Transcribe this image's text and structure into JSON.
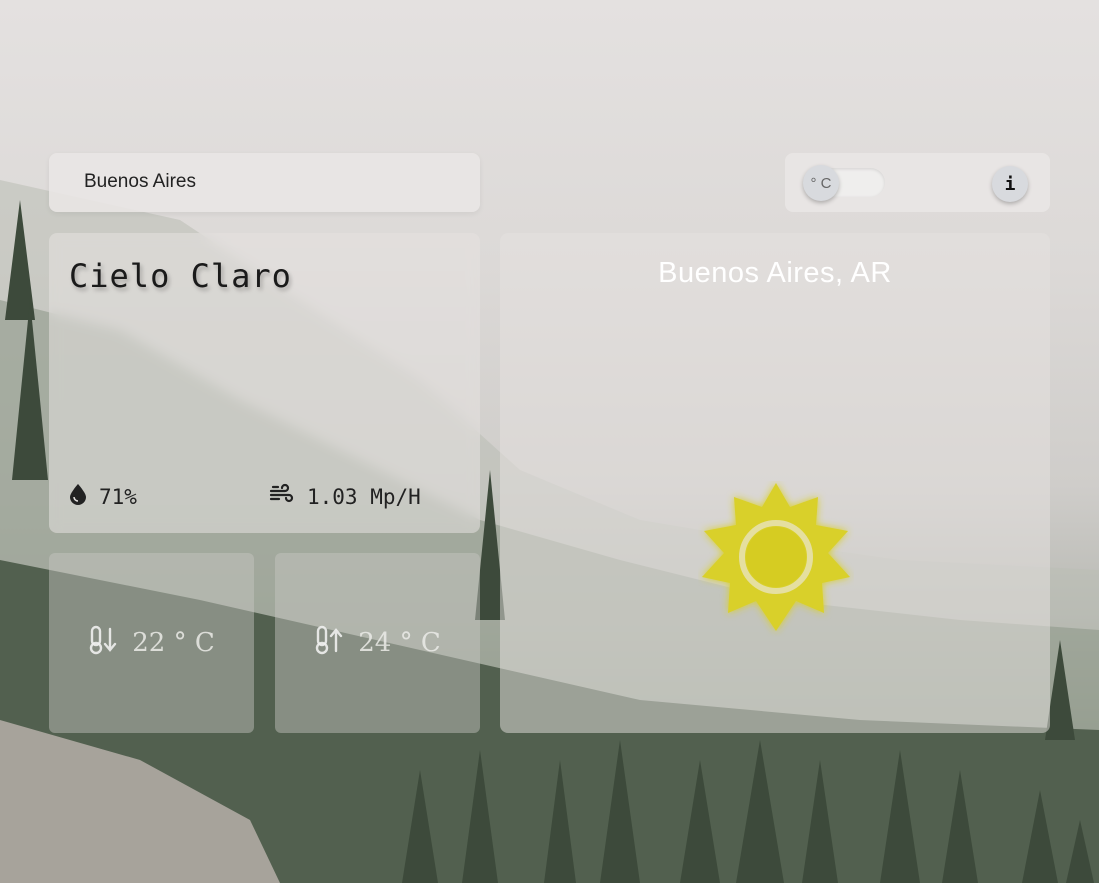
{
  "search": {
    "value": "Buenos Aires",
    "placeholder": ""
  },
  "controls": {
    "unit_label": "° C",
    "unit_selected": "celsius",
    "info_label": "i"
  },
  "weather": {
    "description": "Cielo Claro",
    "humidity": "71%",
    "wind": "1.03 Mp/H",
    "temp_min": "22 ° C",
    "temp_max": "24 ° C",
    "city": "Buenos Aires, AR",
    "condition_icon": "sun-icon"
  },
  "colors": {
    "sun": "#d9d02a",
    "panel": "#e5e2e0"
  },
  "icons": {
    "humidity": "water-drop-icon",
    "wind": "wind-icon",
    "temp_min": "thermometer-down-icon",
    "temp_max": "thermometer-up-icon"
  }
}
